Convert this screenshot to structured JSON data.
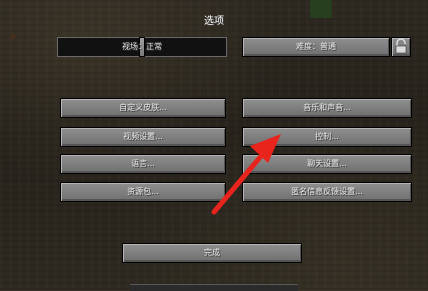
{
  "screen": {
    "title": "选项"
  },
  "fov_slider": {
    "label": "视场：正常",
    "value_fraction": 0.5
  },
  "difficulty_button": {
    "label": "难度：普通"
  },
  "buttons": {
    "skin": "自定义皮肤...",
    "music": "音乐和声音...",
    "video": "视频设置...",
    "controls": "控制...",
    "language": "语言...",
    "chat": "聊天设置...",
    "resource_packs": "资源包...",
    "snooper": "匿名信息反馈设置..."
  },
  "done_button": {
    "label": "完成"
  },
  "annotation": {
    "color": "#e8241d"
  },
  "icons": {
    "lock": "lock-icon"
  }
}
